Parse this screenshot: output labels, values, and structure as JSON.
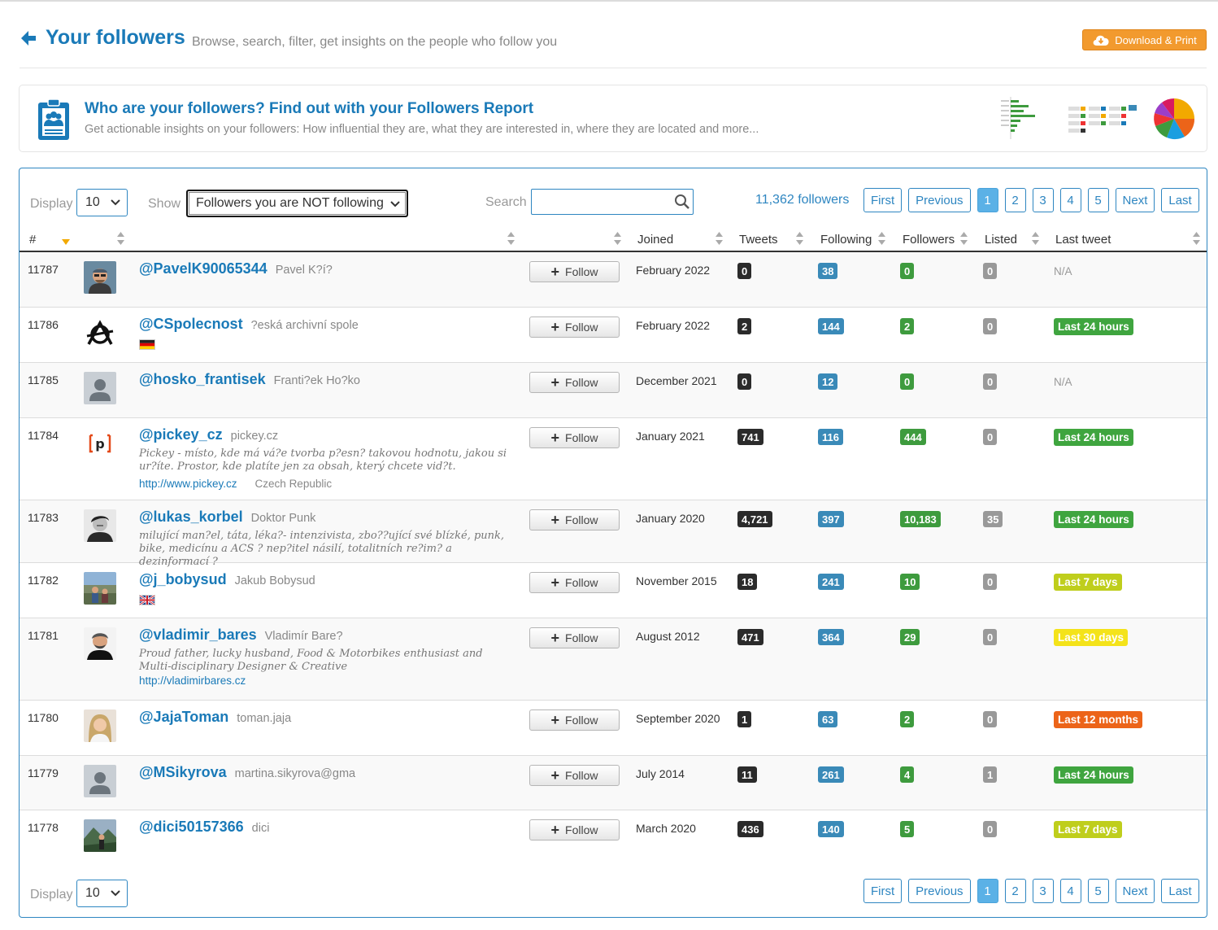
{
  "header": {
    "title": "Your followers",
    "subtitle": "Browse, search, filter, get insights on the people who follow you",
    "download_label": "Download & Print"
  },
  "report": {
    "title": "Who are your followers? Find out with your Followers Report",
    "subtitle": "Get actionable insights on your followers: How influential they are, what they are interested in, where they are located and more..."
  },
  "controls": {
    "display_label": "Display",
    "display_value": "10",
    "show_label": "Show",
    "show_value": "Followers you are NOT following",
    "search_label": "Search",
    "search_value": "",
    "count_text": "11,362 followers"
  },
  "pager": {
    "first": "First",
    "previous": "Previous",
    "pages": [
      "1",
      "2",
      "3",
      "4",
      "5"
    ],
    "active_page": "1",
    "next": "Next",
    "last": "Last"
  },
  "table": {
    "headers": {
      "num": "#",
      "joined": "Joined",
      "tweets": "Tweets",
      "following": "Following",
      "followers": "Followers",
      "listed": "Listed",
      "last_tweet": "Last tweet"
    },
    "follow_label": "Follow",
    "rows": [
      {
        "num": "11787",
        "handle": "@PavelK90065344",
        "name": "Pavel K?í?",
        "joined": "February 2022",
        "tweets": "0",
        "following": "38",
        "followers": "0",
        "listed": "0",
        "last_tweet": "N/A",
        "status": "na",
        "avatar": "photo-glasses"
      },
      {
        "num": "11786",
        "handle": "@CSpolecnost",
        "name": "?eská archivní spole",
        "joined": "February 2022",
        "tweets": "2",
        "following": "144",
        "followers": "2",
        "listed": "0",
        "last_tweet": "Last 24 hours",
        "status": "green",
        "avatar": "logo-symbol",
        "flag": "de"
      },
      {
        "num": "11785",
        "handle": "@hosko_frantisek",
        "name": "Franti?ek Ho?ko",
        "joined": "December 2021",
        "tweets": "0",
        "following": "12",
        "followers": "0",
        "listed": "0",
        "last_tweet": "N/A",
        "status": "na",
        "avatar": "default"
      },
      {
        "num": "11784",
        "handle": "@pickey_cz",
        "name": "pickey.cz",
        "joined": "January 2021",
        "tweets": "741",
        "following": "116",
        "followers": "444",
        "listed": "0",
        "last_tweet": "Last 24 hours",
        "status": "green",
        "avatar": "logo-p",
        "bio": "Pickey - místo, kde má vá?e tvorba p?esn? takovou hodnotu, jakou si ur?íte. Prostor, kde platíte jen za obsah, který chcete vid?t.",
        "url": "http://www.pickey.cz",
        "location": "Czech Republic"
      },
      {
        "num": "11783",
        "handle": "@lukas_korbel",
        "name": "Doktor Punk",
        "joined": "January 2020",
        "tweets": "4,721",
        "following": "397",
        "followers": "10,183",
        "listed": "35",
        "last_tweet": "Last 24 hours",
        "status": "green",
        "avatar": "photo-bw",
        "bio": "milující man?el, táta, léka?- intenzivista, zbo??ující své blízké, punk, bike, medicínu a ACS ? nep?itel násilí, totalitních re?im? a dezinformací ?"
      },
      {
        "num": "11782",
        "handle": "@j_bobysud",
        "name": "Jakub Bobysud",
        "joined": "November 2015",
        "tweets": "18",
        "following": "241",
        "followers": "10",
        "listed": "0",
        "last_tweet": "Last 7 days",
        "status": "yellowgreen",
        "avatar": "photo-outdoor",
        "flag": "gb"
      },
      {
        "num": "11781",
        "handle": "@vladimir_bares",
        "name": "Vladimír Bare?",
        "joined": "August 2012",
        "tweets": "471",
        "following": "364",
        "followers": "29",
        "listed": "0",
        "last_tweet": "Last 30 days",
        "status": "yellow",
        "avatar": "photo-man",
        "bio": "Proud father, lucky husband, Food & Motorbikes enthusiast and Multi-disciplinary Designer & Creative",
        "url": "http://vladimirbares.cz"
      },
      {
        "num": "11780",
        "handle": "@JajaToman",
        "name": "toman.jaja",
        "joined": "September 2020",
        "tweets": "1",
        "following": "63",
        "followers": "2",
        "listed": "0",
        "last_tweet": "Last 12 months",
        "status": "orange",
        "avatar": "photo-woman"
      },
      {
        "num": "11779",
        "handle": "@MSikyrova",
        "name": "martina.sikyrova@gma",
        "joined": "July 2014",
        "tweets": "11",
        "following": "261",
        "followers": "4",
        "listed": "1",
        "last_tweet": "Last 24 hours",
        "status": "green",
        "avatar": "default"
      },
      {
        "num": "11778",
        "handle": "@dici50157366",
        "name": "dici",
        "joined": "March 2020",
        "tweets": "436",
        "following": "140",
        "followers": "5",
        "listed": "0",
        "last_tweet": "Last 7 days",
        "status": "yellowgreen",
        "avatar": "photo-mountain"
      }
    ]
  },
  "colors": {
    "accent": "#1a7ab8",
    "panel_border": "#2e86c1",
    "download": "#f29a2e",
    "status_green": "#3fa53f",
    "status_yellowgreen": "#bfce1c",
    "status_yellow": "#f4e31a",
    "status_orange": "#ec6419"
  }
}
